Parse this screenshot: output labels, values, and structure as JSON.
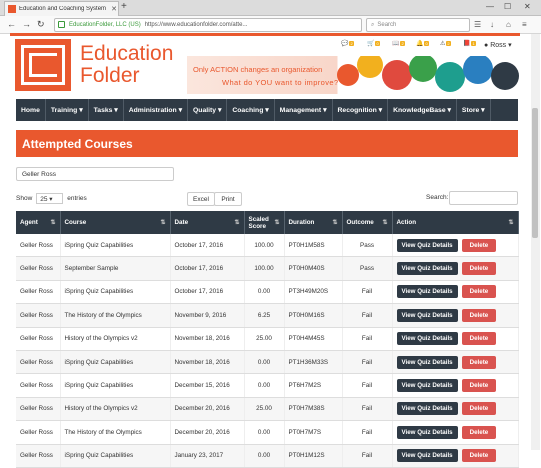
{
  "browser": {
    "tab_title": "Education and Coaching System",
    "secure_label": "EducationFolder, LLC (US)",
    "url": "https://www.educationfolder.com/atte...",
    "search_placeholder": "Search"
  },
  "logo": {
    "line1": "Education",
    "line2": "Folder"
  },
  "header_icons": [
    {
      "icon": "comment-icon",
      "count": "2"
    },
    {
      "icon": "cart-icon",
      "count": "0"
    },
    {
      "icon": "book-icon",
      "count": "2"
    },
    {
      "icon": "bell-icon",
      "count": "0"
    },
    {
      "icon": "warning-icon",
      "count": "2"
    },
    {
      "icon": "book-icon",
      "count": "1"
    }
  ],
  "user": {
    "name": "Ross"
  },
  "banner": {
    "line1": "Only ACTION changes an organization",
    "line2": "What do YOU want to improve?"
  },
  "menu": [
    "Home",
    "Training",
    "Tasks",
    "Administration",
    "Quality",
    "Coaching",
    "Management",
    "Recognition",
    "KnowledgeBase",
    "Store"
  ],
  "page_title": "Attempted Courses",
  "filter_value": "Geller Ross",
  "controls": {
    "show_label": "Show",
    "show_value": "25",
    "entries_label": "entries",
    "excel": "Excel",
    "print": "Print",
    "search_label": "Search:"
  },
  "table": {
    "headers": [
      "Agent",
      "Course",
      "Date",
      "Scaled Score",
      "Duration",
      "Outcome",
      "Action"
    ],
    "view_label": "View Quiz Details",
    "delete_label": "Delete",
    "rows": [
      [
        "Geller Ross",
        "iSpring Quiz Capabilities",
        "October 17, 2016",
        "100.00",
        "PT0H1M58S",
        "Pass"
      ],
      [
        "Geller Ross",
        "September Sample",
        "October 17, 2016",
        "100.00",
        "PT0H0M40S",
        "Pass"
      ],
      [
        "Geller Ross",
        "iSpring Quiz Capabilities",
        "October 17, 2016",
        "0.00",
        "PT3H49M20S",
        "Fail"
      ],
      [
        "Geller Ross",
        "The History of the Olympics",
        "November 9, 2016",
        "6.25",
        "PT0H0M16S",
        "Fail"
      ],
      [
        "Geller Ross",
        "History of the Olympics v2",
        "November 18, 2016",
        "25.00",
        "PT0H4M45S",
        "Fail"
      ],
      [
        "Geller Ross",
        "iSpring Quiz Capabilities",
        "November 18, 2016",
        "0.00",
        "PT1H36M33S",
        "Fail"
      ],
      [
        "Geller Ross",
        "iSpring Quiz Capabilities",
        "December 15, 2016",
        "0.00",
        "PT6H7M2S",
        "Fail"
      ],
      [
        "Geller Ross",
        "History of the Olympics v2",
        "December 20, 2016",
        "25.00",
        "PT0H7M38S",
        "Fail"
      ],
      [
        "Geller Ross",
        "The History of the Olympics",
        "December 20, 2016",
        "0.00",
        "PT0H7M7S",
        "Fail"
      ],
      [
        "Geller Ross",
        "iSpring Quiz Capabilities",
        "January 23, 2017",
        "0.00",
        "PT0H1M12S",
        "Fail"
      ]
    ]
  },
  "colors": {
    "brand": "#e9582e",
    "dark": "#2f3a45",
    "danger": "#d9534f",
    "badge": "#f2b01e"
  }
}
